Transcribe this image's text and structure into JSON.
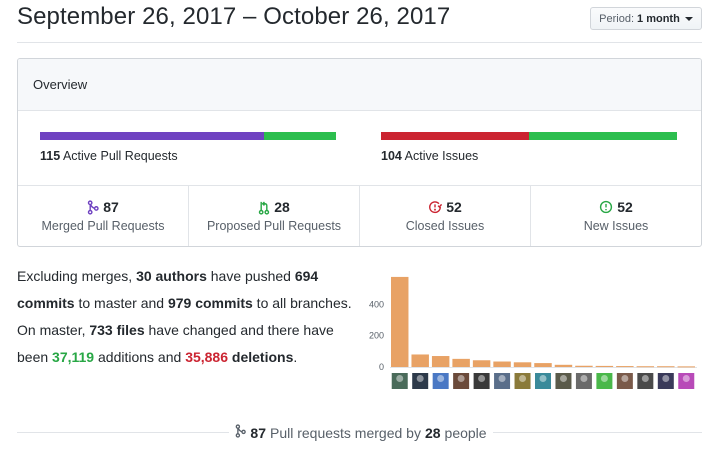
{
  "header": {
    "date_range": "September 26, 2017 – October 26, 2017",
    "period_prefix": "Period:",
    "period_value": "1 month"
  },
  "overview": {
    "title": "Overview",
    "pull_requests": {
      "count": "115",
      "label": "Active Pull Requests",
      "merged_fraction": 0.757,
      "open_fraction": 0.243,
      "merged_color": "#6f42c1",
      "open_color": "#2cbe4e"
    },
    "issues": {
      "count": "104",
      "label": "Active Issues",
      "closed_fraction": 0.5,
      "new_fraction": 0.5,
      "closed_color": "#cb2431",
      "new_color": "#2cbe4e"
    },
    "stats": [
      {
        "icon": "merged-pr-icon",
        "value": "87",
        "label": "Merged Pull Requests",
        "color": "#6f42c1"
      },
      {
        "icon": "open-pr-icon",
        "value": "28",
        "label": "Proposed Pull Requests",
        "color": "#28a745"
      },
      {
        "icon": "closed-issue-icon",
        "value": "52",
        "label": "Closed Issues",
        "color": "#cb2431"
      },
      {
        "icon": "open-issue-icon",
        "value": "52",
        "label": "New Issues",
        "color": "#28a745"
      }
    ]
  },
  "summary": {
    "t1": "Excluding merges, ",
    "authors": "30 authors",
    "t2": " have pushed ",
    "commits_master": "694 commits",
    "t3": " to master and ",
    "commits_all": "979 commits",
    "t4": " to all branches. On master, ",
    "files": "733 files",
    "t5": " have changed and there have been ",
    "additions": "37,119",
    "t6": " additions",
    "t7": " and ",
    "deletions": "35,886",
    "t8": " deletions",
    "t9": "."
  },
  "chart_data": {
    "type": "bar",
    "title": "",
    "xlabel": "",
    "ylabel": "",
    "ylim": [
      0,
      600
    ],
    "yticks": [
      "0",
      "200",
      "400"
    ],
    "bar_color": "#e8a265",
    "categories": [
      "author-1",
      "author-2",
      "author-3",
      "author-4",
      "author-5",
      "author-6",
      "author-7",
      "author-8",
      "author-9",
      "author-10",
      "author-11",
      "author-12",
      "author-13",
      "author-14",
      "author-15"
    ],
    "values": [
      575,
      80,
      70,
      52,
      43,
      35,
      30,
      25,
      14,
      8,
      7,
      6,
      5,
      5,
      4
    ]
  },
  "merged_summary": {
    "count": "87",
    "t1": " Pull requests merged by ",
    "people": "28",
    "t2": " people"
  },
  "avatar_colors": [
    "#4a6b5a",
    "#2d3a4a",
    "#4a78c4",
    "#6b4a3a",
    "#3a3a3a",
    "#5a6e8a",
    "#8a7a3a",
    "#3a8a9a",
    "#5a5a4a",
    "#6a6a6a",
    "#4ab84a",
    "#7a5a4a",
    "#4a4a4a",
    "#3a3a5a",
    "#b84ab8"
  ]
}
